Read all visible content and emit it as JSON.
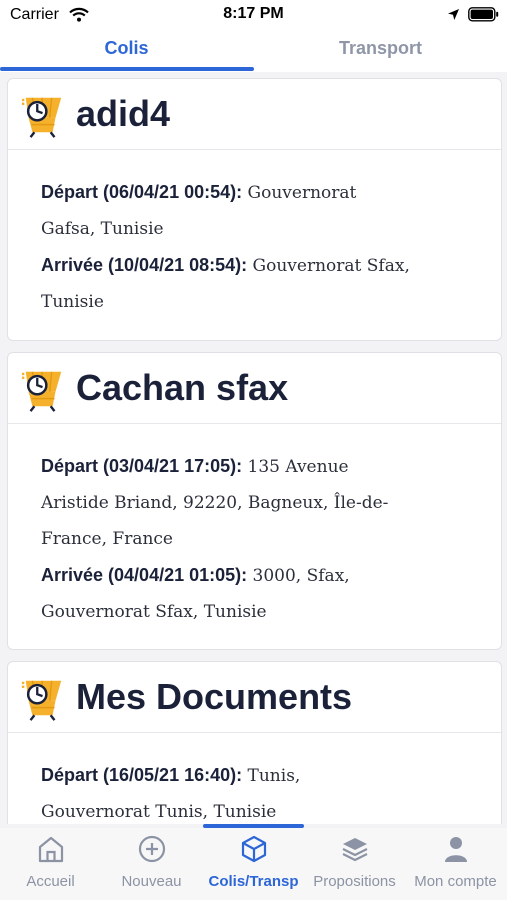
{
  "status_bar": {
    "carrier": "Carrier",
    "time": "8:17 PM"
  },
  "tabs": [
    {
      "label": "Colis",
      "active": true
    },
    {
      "label": "Transport",
      "active": false
    }
  ],
  "cards": [
    {
      "title": "adid4",
      "departure_label": "Départ (06/04/21 00:54):",
      "departure_lines": [
        "Gouvernorat",
        "Gafsa, Tunisie"
      ],
      "arrival_label": "Arrivée (10/04/21 08:54):",
      "arrival_lines": [
        "Gouvernorat Sfax,",
        "Tunisie"
      ]
    },
    {
      "title": "Cachan sfax",
      "departure_label": "Départ (03/04/21 17:05):",
      "departure_lines": [
        "135 Avenue",
        "Aristide Briand, 92220, Bagneux, Île-de-",
        "France, France"
      ],
      "arrival_label": "Arrivée (04/04/21 01:05):",
      "arrival_lines": [
        "3000, Sfax,",
        "Gouvernorat Sfax, Tunisie"
      ]
    },
    {
      "title": "Mes Documents",
      "departure_label": "Départ (16/05/21 16:40):",
      "departure_lines": [
        "Tunis,",
        "Gouvernorat Tunis, Tunisie"
      ]
    }
  ],
  "bottom_nav": [
    {
      "label": "Accueil",
      "icon": "home-icon"
    },
    {
      "label": "Nouveau",
      "icon": "plus-circle-icon"
    },
    {
      "label": "Colis/Transp",
      "icon": "box-icon",
      "active": true
    },
    {
      "label": "Propositions",
      "icon": "layers-icon"
    },
    {
      "label": "Mon compte",
      "icon": "user-icon"
    }
  ],
  "colors": {
    "accent": "#2d66d6",
    "title": "#1a2139",
    "inactive": "#8c93a4",
    "icon_yellow": "#f5b12c"
  }
}
